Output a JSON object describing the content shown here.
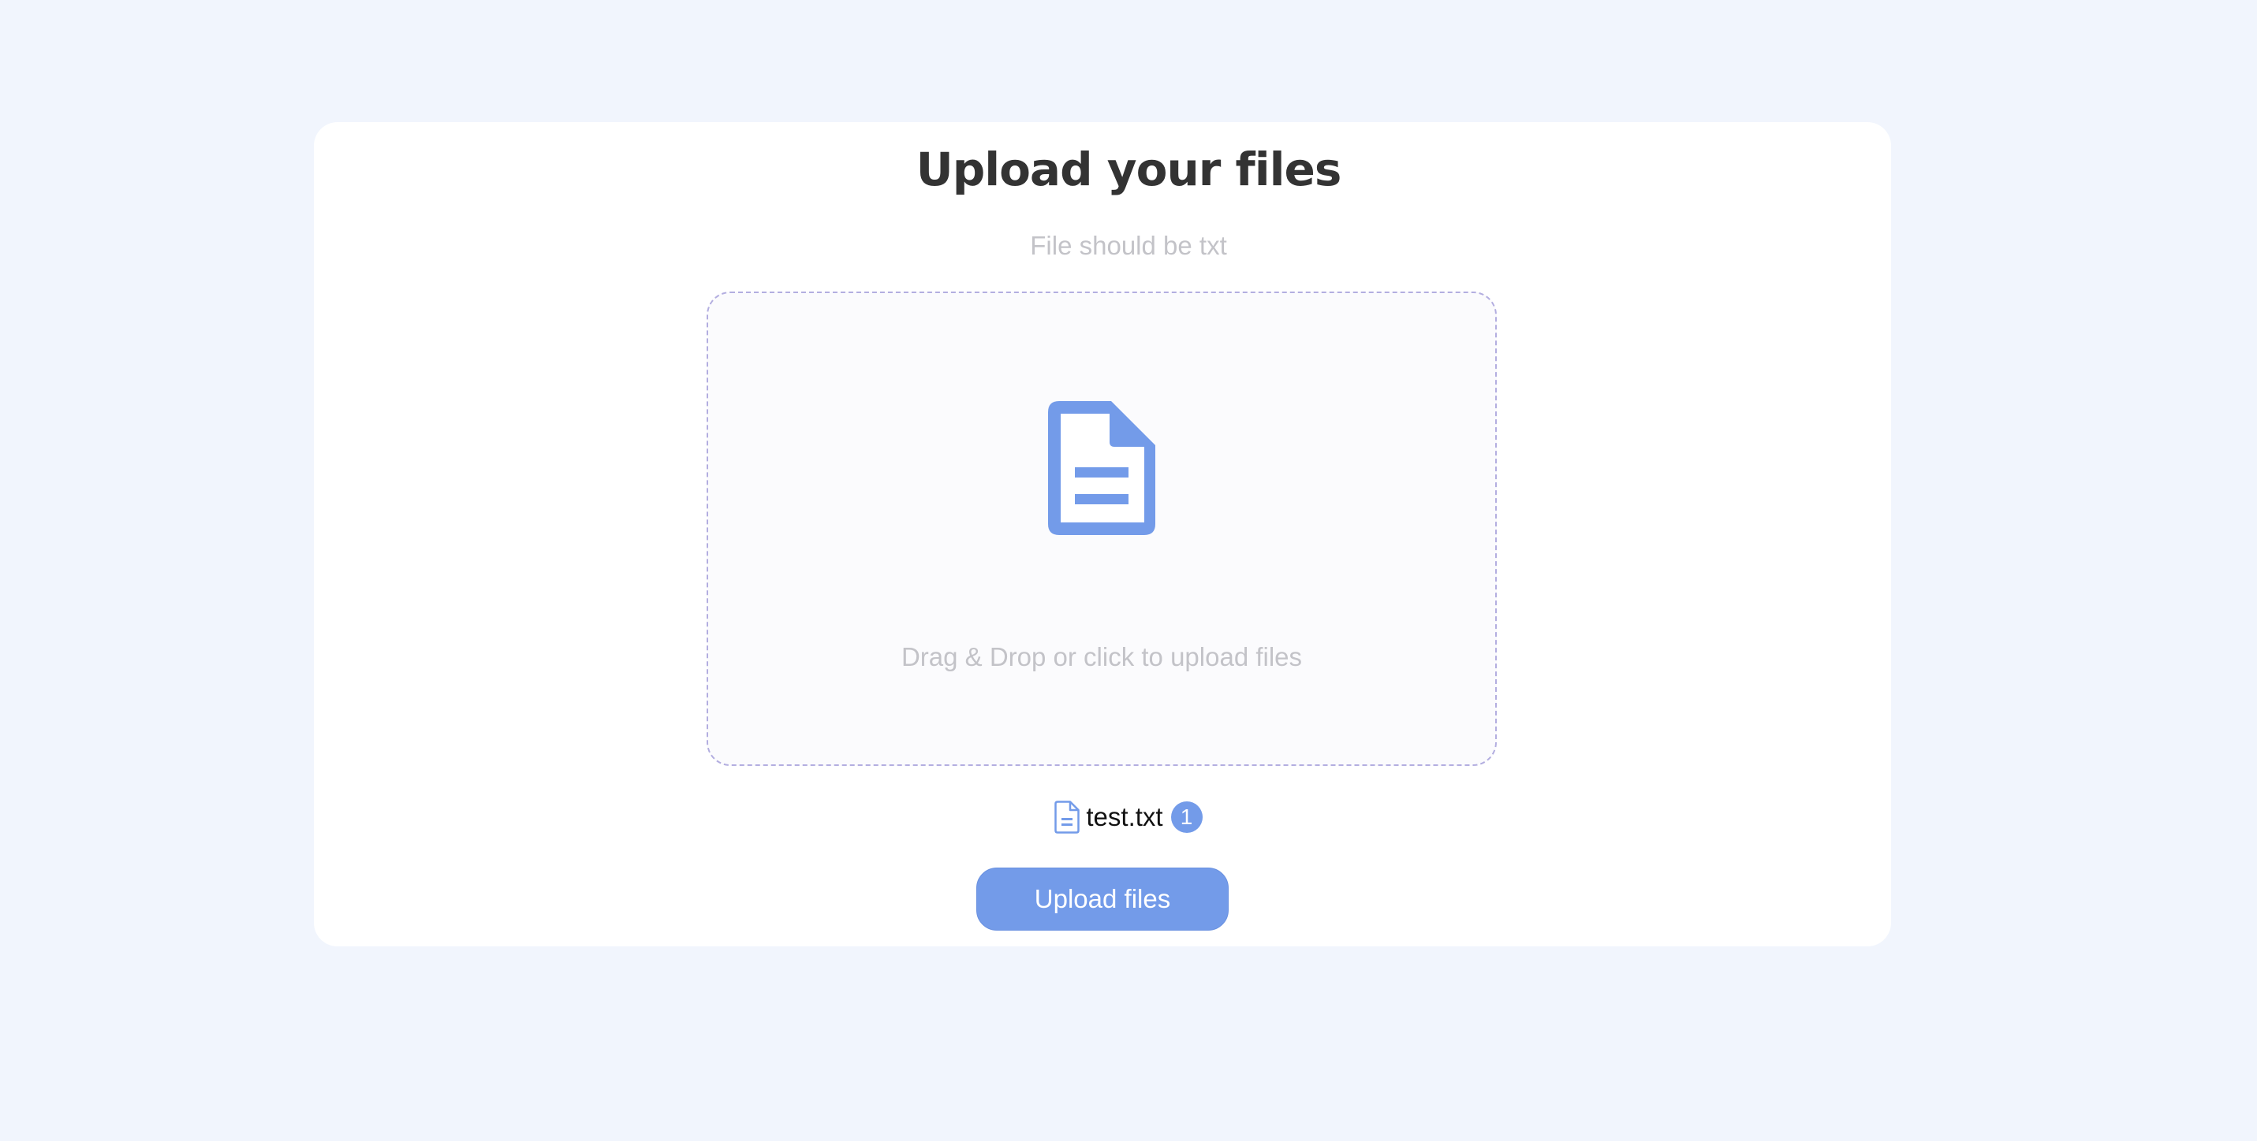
{
  "colors": {
    "background": "#f1f5fd",
    "card": "#ffffff",
    "accent": "#739be9",
    "muted_text": "#c3c3c8",
    "title_text": "#333333",
    "dropzone_border": "#b3aee0"
  },
  "header": {
    "title": "Upload your files",
    "subtitle": "File should be txt"
  },
  "dropzone": {
    "icon": "document-icon",
    "hint": "Drag & Drop or click to upload files"
  },
  "selected_files": [
    {
      "name": "test.txt",
      "count": "1",
      "icon": "document-icon"
    }
  ],
  "actions": {
    "upload_label": "Upload files"
  }
}
